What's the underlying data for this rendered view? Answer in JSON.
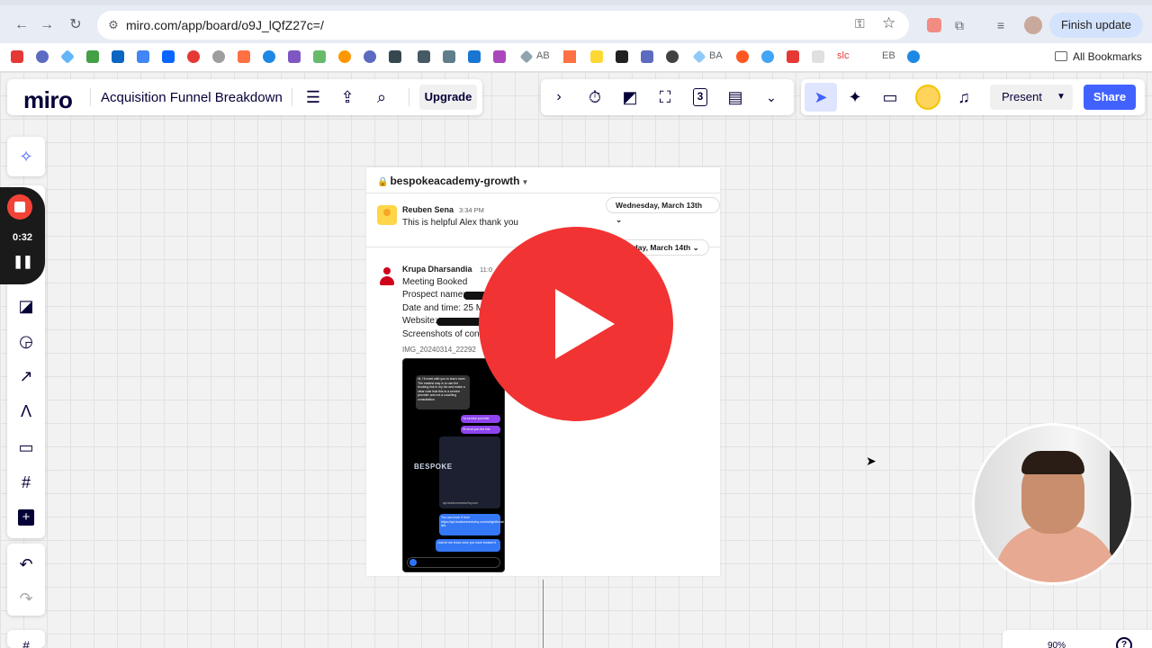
{
  "browser": {
    "url": "miro.com/app/board/o9J_lQfZ27c=/",
    "finish_update": "Finish update",
    "all_bookmarks": "All Bookmarks",
    "bookmark_labels": [
      "AB",
      "BA",
      "slc",
      "EB"
    ]
  },
  "miro": {
    "logo": "miro",
    "board_title": "Acquisition Funnel Breakdown",
    "upgrade": "Upgrade",
    "present": "Present",
    "share": "Share",
    "timer_count": "3",
    "zoom": "90%"
  },
  "recording": {
    "time": "0:32"
  },
  "slack": {
    "channel": "bespokeacademy-growth",
    "date1": "Wednesday, March 13th",
    "date2": "Thursday, March 14th",
    "messages": [
      {
        "sender": "Reuben Sena",
        "time": "3:34 PM",
        "text": "This is helpful Alex thank you"
      },
      {
        "sender": "Krupa Dharsandia",
        "time": "11:0",
        "lines": [
          "Meeting Booked",
          "Prospect name:",
          "Date and time: 25 M",
          "Website:",
          "Screenshots of conv"
        ]
      }
    ],
    "attachment": "IMG_20240314_22292",
    "phone": {
      "bubble1": "Hi, I'll meet with you to learn more. The easiest way is to use the booking link in my bio and make a clear note that this is a service provider and not a coaching consultation.",
      "bubble2": "Ya service provider",
      "bubble3": "I'll send you the link",
      "logo": "BESPOKE",
      "link_preview": "api.leadconnectorhq.com",
      "bubble4": "You can book it from https://api.leadconnectorhq.com/widget/booking/bespokeacademy link",
      "bubble5": "Just let me know once you have booked it"
    }
  },
  "colors": {
    "miro_blue": "#4262ff",
    "play_red": "#f23333",
    "record_red": "#f44336"
  }
}
